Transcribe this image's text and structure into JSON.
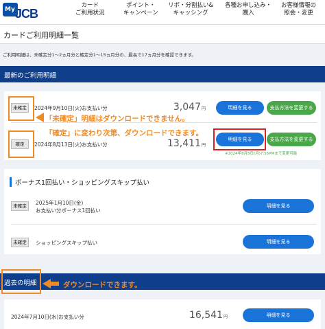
{
  "header": {
    "logo_my": "My",
    "logo_brand": "JCB",
    "nav": [
      {
        "line1": "カード",
        "line2": "ご利用状況"
      },
      {
        "line1": "ポイント・",
        "line2": "キャンペーン"
      },
      {
        "line1": "リボ・分割払い&",
        "line2": "キャッシング"
      },
      {
        "line1": "各種お申し込み・",
        "line2": "購入"
      },
      {
        "line1": "お客様情報の",
        "line2": "照会・変更"
      }
    ]
  },
  "page_title": "カードご利用明細一覧",
  "note": "ご利用明細は、未確定分1〜2ヵ月分と確定分1〜15ヵ月分の、最長で17ヵ月分を確認できます。",
  "recent": {
    "title": "最新のご利用明細",
    "rows": [
      {
        "status": "未確定",
        "date": "2024年9月10日(火)お支払い分",
        "amount": "3,047",
        "yen": "円",
        "view": "明細を見る",
        "change": "支払方法を変更する"
      },
      {
        "status": "確定",
        "date": "2024年8月13日(火)お支払い分",
        "amount": "13,411",
        "yen": "円",
        "view": "明細を見る",
        "change": "支払方法を変更する",
        "change_note": "※2024年8月5日(月)7:55PMまで変更可能"
      }
    ]
  },
  "bonus": {
    "title": "ボーナス1回払い・ショッピングスキップ払い",
    "rows": [
      {
        "status": "未確定",
        "line1": "2025年1月10日(金)",
        "line2": "お支払い分ボーナス1回払い",
        "view": "明細を見る"
      },
      {
        "status": "未確定",
        "line1": "ショッピングスキップ払い",
        "view": "明細を見る"
      }
    ]
  },
  "past": {
    "title": "過去の明細",
    "rows": [
      {
        "date": "2024年7月10日(水)お支払い分",
        "amount": "16,541",
        "yen": "円",
        "view": "明細を見る"
      }
    ]
  },
  "callouts": {
    "unconfirmed": "「未確定」明細はダウンロードできません。",
    "confirmed": "「確定」に変わり次第、ダウンロードできます。",
    "past": "ダウンロードできます。"
  },
  "colors": {
    "brand_blue": "#0f3e8a",
    "button_blue": "#1a73d9",
    "button_green": "#4aa84a",
    "callout_orange": "#f08a24",
    "highlight_red": "#e02020"
  }
}
